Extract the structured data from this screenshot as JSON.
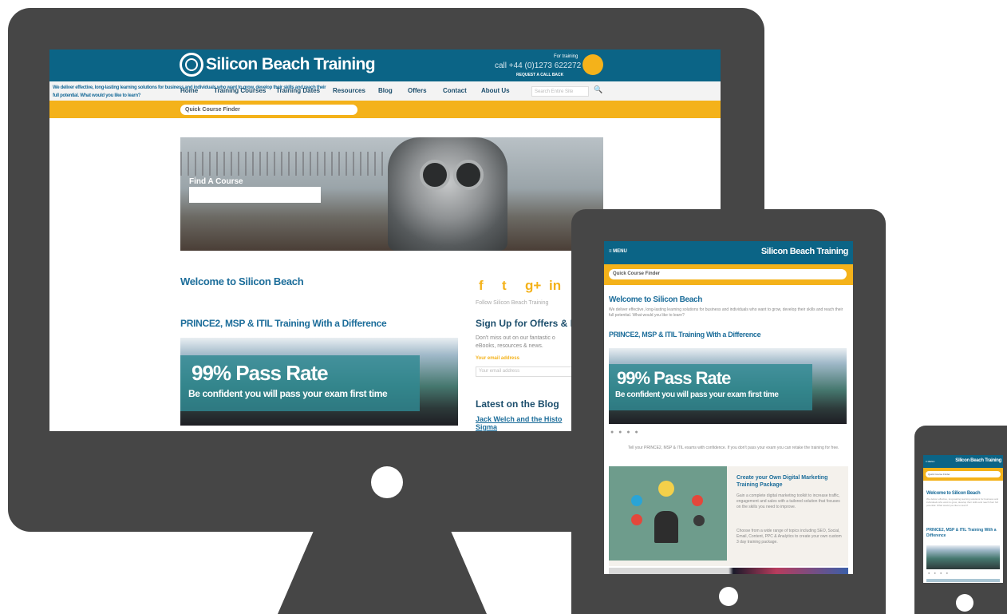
{
  "desktop": {
    "brand": "Silicon Beach Training",
    "call_small": "For training",
    "call_number": "call +44 (0)1273 622272",
    "callback": "REQUEST A CALL BACK",
    "nav": [
      "Home",
      "Training Courses",
      "Training Dates",
      "Resources",
      "Blog",
      "Offers",
      "Contact",
      "About Us"
    ],
    "search_placeholder": "Search Entire Site",
    "quick_finder": "Quick Course Finder",
    "find_course": "Find A Course",
    "welcome_title": "Welcome to Silicon Beach",
    "welcome_text": "We deliver effective, long-lasting learning solutions for business and individuals who want to grow, develop their skills and reach their full potential. What would you like to learn?",
    "prince_title": "PRINCE2, MSP & ITIL Training With a Difference",
    "banner_pass": "99% Pass Rate",
    "banner_sub": "Be confident you will pass your exam first time",
    "social": [
      "f",
      "t",
      "g+",
      "in"
    ],
    "follow": "Follow Silicon Beach Training",
    "signup_title": "Sign Up for Offers & N",
    "signup_text": "Don't miss out on our fantastic o eBooks, resources & news.",
    "email_label": "Your email address",
    "email_placeholder": "Your email address",
    "blog_title": "Latest on the Blog",
    "blog_link": "Jack Welch and the Histo Sigma"
  },
  "tablet": {
    "menu": "≡ MENU",
    "brand": "Silicon Beach Training",
    "quick_finder": "Quick Course Finder",
    "welcome_title": "Welcome to Silicon Beach",
    "welcome_text": "We deliver effective, long-lasting learning solutions for business and individuals who want to grow, develop their skills and reach their full potential. What would you like to learn?",
    "prince_title": "PRINCE2, MSP & ITIL Training With a Difference",
    "banner_pass": "99% Pass Rate",
    "banner_sub": "Be confident you will pass your exam first time",
    "dots": "● ● ● ●",
    "pass_text": "Tell your PRINCE2, MSP & ITIL exams with confidence. If you don't pass your exam you can retake the training for free.",
    "card_title": "Create your Own Digital Marketing Training Package",
    "card_text": "Gain a complete digital marketing toolkit to increase traffic, engagement and sales with a tailored solution that focuses on the skills you need to improve.",
    "card_text2": "Choose from a wide range of topics including SEO, Social, Email, Content, PPC & Analytics to create your own custom 3 day training package."
  },
  "phone": {
    "menu": "≡ MENU",
    "brand": "Silicon Beach Training",
    "quick_finder": "Quick Course Finder",
    "welcome_title": "Welcome to Silicon Beach",
    "welcome_text": "We deliver effective, long-lasting learning solutions for business and individuals who want to grow, develop their skills and reach their full potential. What would you like to learn?",
    "prince_title": "PRINCE2, MSP & ITIL Training With a Difference",
    "dots": "● ● ● ●"
  },
  "colors": {
    "brand_blue": "#0b6486",
    "accent_yellow": "#f4b21a",
    "device_gray": "#464646"
  }
}
